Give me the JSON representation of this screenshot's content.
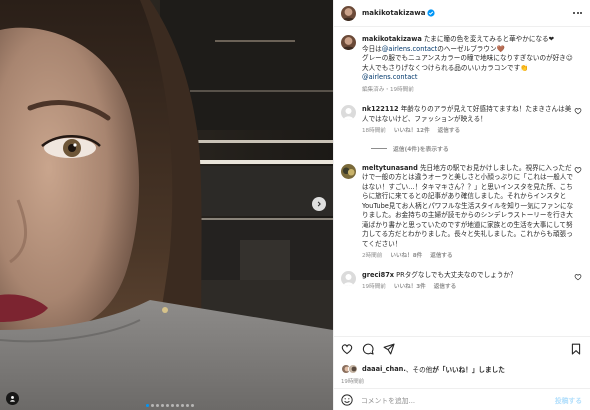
{
  "colors": {
    "link": "#00376b",
    "verified": "#0095f6",
    "muted": "#8e8e8e",
    "post_disabled": "#b2dffc"
  },
  "icons": [
    "chevron-right-icon",
    "user-tag-icon",
    "verified-icon",
    "more-icon",
    "heart-icon",
    "comment-icon",
    "share-icon",
    "save-icon",
    "smiley-icon"
  ],
  "media": {
    "total_slides": 10,
    "active_slide": 1
  },
  "header": {
    "username": "makikotakizawa"
  },
  "caption": {
    "username": "makikotakizawa",
    "line1": "たまに瞳の色を変えてみると華やかになる❤",
    "line2_prefix": "今日は",
    "line2_link": "@airlens.contact",
    "line2_suffix": "のヘーゼルブラウン🤎",
    "line3": "グレーの服でもニュアンスカラーの瞳で地味になりすぎないのが好き☺",
    "line4": "大人でもさりげなくつけられる品のいいカラコンです👏",
    "line5_link": "@airlens.contact",
    "meta": "編集済み・19時間前"
  },
  "comments": [
    {
      "username": "nk122112",
      "text": "年齢なりのアラが見えて好感持てますね！たまきさんは美人ではないけど、ファッションが映える！",
      "time": "18時間前",
      "likes": "いいね！12件",
      "reply": "返信する",
      "view_replies": "返信(4件)を表示する"
    },
    {
      "username": "meltytunasand",
      "text": "先日地方の駅でお見かけしました。視界に入っただけで一般の方とは違うオーラと美しさと小顔っぷりに「これは一般人ではない！すごい…！タキマキさん？？」と思いインスタを見た所、こちらに旅行に来てるとの記事があり確信しました。それからインスタとYouTube見てお人柄とパワフルな生活スタイルを知り一気にファンになりました。お金持ちの主婦が読モからのシンデレラストーリーを行き大滝ばかり書かと思っていたのですが地道に家族との生活を大事にして努力してる方だとわかりました。長々と失礼しました。これからも頑張ってください！",
      "time": "2時間前",
      "likes": "いいね！8件",
      "reply": "返信する"
    },
    {
      "username": "greci87x",
      "text": "PRタグなしでも大丈夫なのでしょうか？",
      "time": "19時間前",
      "likes": "いいね！3件",
      "reply": "返信する"
    }
  ],
  "likes_line": {
    "user": "daaai_chan.",
    "middle": "、その他",
    "suffix": "が「いいね！」しました"
  },
  "post_time": "19時間前",
  "add_comment": {
    "placeholder": "コメントを追加...",
    "post_label": "投稿する"
  }
}
